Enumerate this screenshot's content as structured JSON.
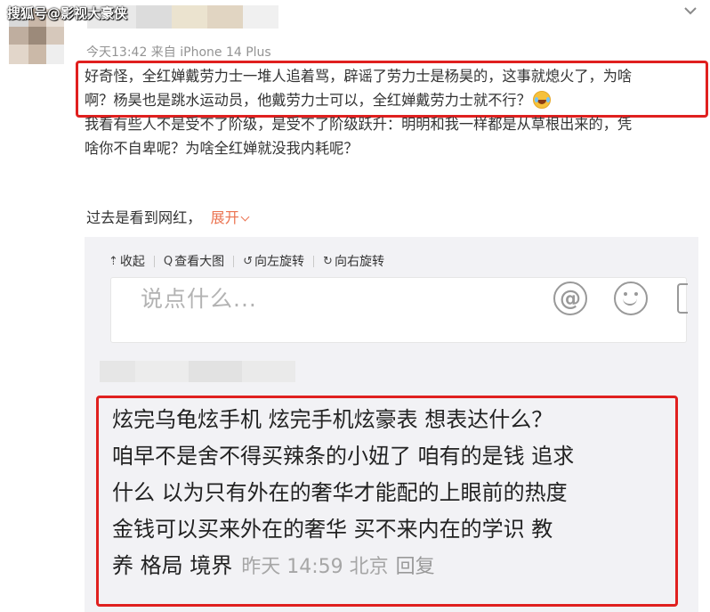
{
  "watermark": "搜狐号@影视大豪侠",
  "post": {
    "meta": "今天13:42  来自 iPhone 14 Plus",
    "lines": [
      "好奇怪，全红婵戴劳力士一堆人追着骂，辟谣了劳力士是杨昊的，这事就熄火了，为啥",
      "啊？杨昊也是跳水运动员，他戴劳力士可以，全红婵戴劳力士就不行？",
      "我看有些人不是受不了阶级，是受不了阶级跃升：明明和我一样都是从草根出来的，凭",
      "啥你不自卑呢？为啥全红婵就没我内耗呢？"
    ],
    "emoji": "laughing-tears-emoji"
  },
  "expand": {
    "prefix": "过去是看到网红，",
    "link": "展开"
  },
  "toolbar": {
    "collapse": "收起",
    "view_large": "查看大图",
    "rotate_left": "向左旋转",
    "rotate_right": "向右旋转"
  },
  "comment": {
    "placeholder": "说点什么..."
  },
  "reply": {
    "lines": [
      "炫完乌龟炫手机 炫完手机炫豪表 想表达什么？",
      "咱早不是舍不得买辣条的小妞了 咱有的是钱 追求",
      "什么 以为只有外在的奢华才能配的上眼前的热度",
      "金钱可以买来外在的奢华  买不来内在的学识 教",
      "养 格局 境界"
    ],
    "time": "昨天 14:59 北京",
    "reply_label": "回复"
  },
  "colors": {
    "highlight_border": "#e0201f",
    "link_orange": "#eb7350",
    "meta_gray": "#939393"
  }
}
